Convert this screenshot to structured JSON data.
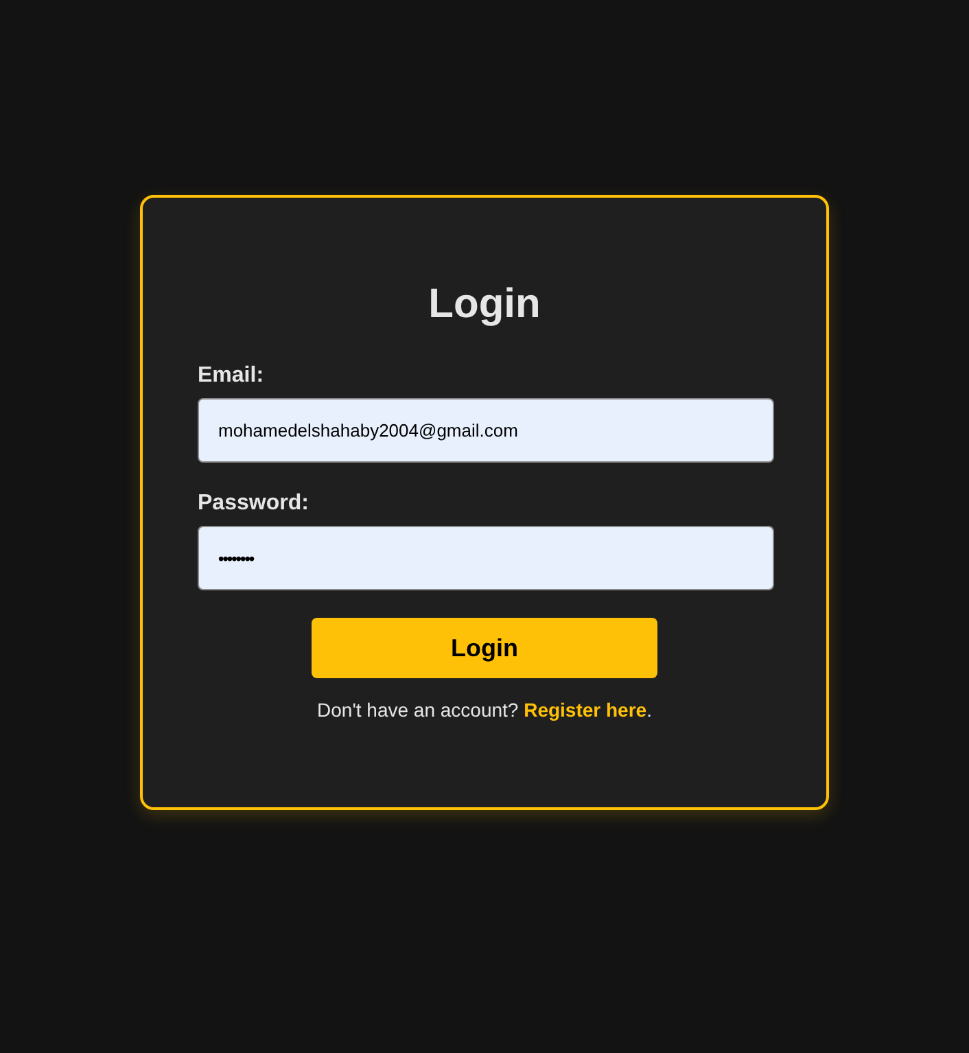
{
  "card": {
    "title": "Login",
    "fields": [
      {
        "kind": "email",
        "label": "Email:",
        "value": "mohamedelshahaby2004@gmail.com"
      },
      {
        "kind": "password",
        "label": "Password:",
        "value": "••••••••"
      }
    ],
    "button": "Login",
    "footer": {
      "text": "Don't have an account?",
      "link": "Register here",
      "suffix": "."
    }
  }
}
